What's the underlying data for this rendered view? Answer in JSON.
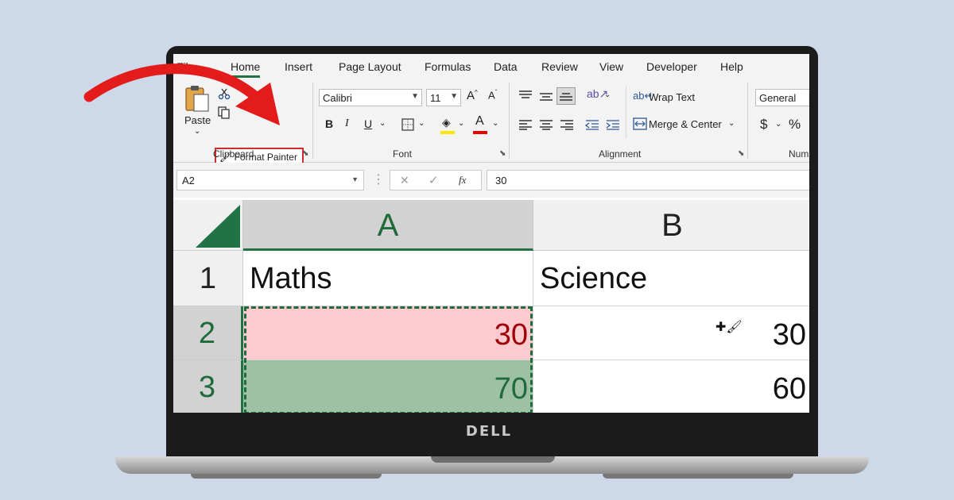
{
  "ribbon": {
    "tabs": [
      "File",
      "Home",
      "Insert",
      "Page Layout",
      "Formulas",
      "Data",
      "Review",
      "View",
      "Developer",
      "Help"
    ],
    "active_tab": "Home",
    "clipboard": {
      "paste_label": "Paste",
      "format_painter_label": "Format Painter",
      "group_label": "Clipboard"
    },
    "font": {
      "font_name": "Calibri",
      "font_size": "11",
      "group_label": "Font"
    },
    "alignment": {
      "wrap_text_label": "Wrap Text",
      "merge_center_label": "Merge & Center",
      "group_label": "Alignment"
    },
    "number": {
      "format": "General",
      "currency_symbol": "$",
      "percent_symbol": "%",
      "group_label_partial": "Num"
    }
  },
  "formula_bar": {
    "name_box": "A2",
    "cancel_symbol": "✕",
    "enter_symbol": "✓",
    "fx_symbol": "fx",
    "formula_value": "30"
  },
  "sheet": {
    "columns": [
      "A",
      "B"
    ],
    "rows": [
      "1",
      "2",
      "3"
    ],
    "cells": {
      "A1": "Maths",
      "B1": "Science",
      "A2": "30",
      "B2": "30",
      "A3": "70",
      "B3": "60"
    },
    "fill_colors": {
      "A2": "#fccacf",
      "A3": "#9ec1a3"
    },
    "font_colors": {
      "A2": "#9c0006",
      "A3": "#1f6b3a"
    }
  },
  "device": {
    "brand": "DELL"
  },
  "icons": [
    "paste-icon",
    "cut-icon",
    "copy-icon",
    "format-painter-icon",
    "red-arrow-annotation",
    "paintbrush-cursor-icon"
  ]
}
